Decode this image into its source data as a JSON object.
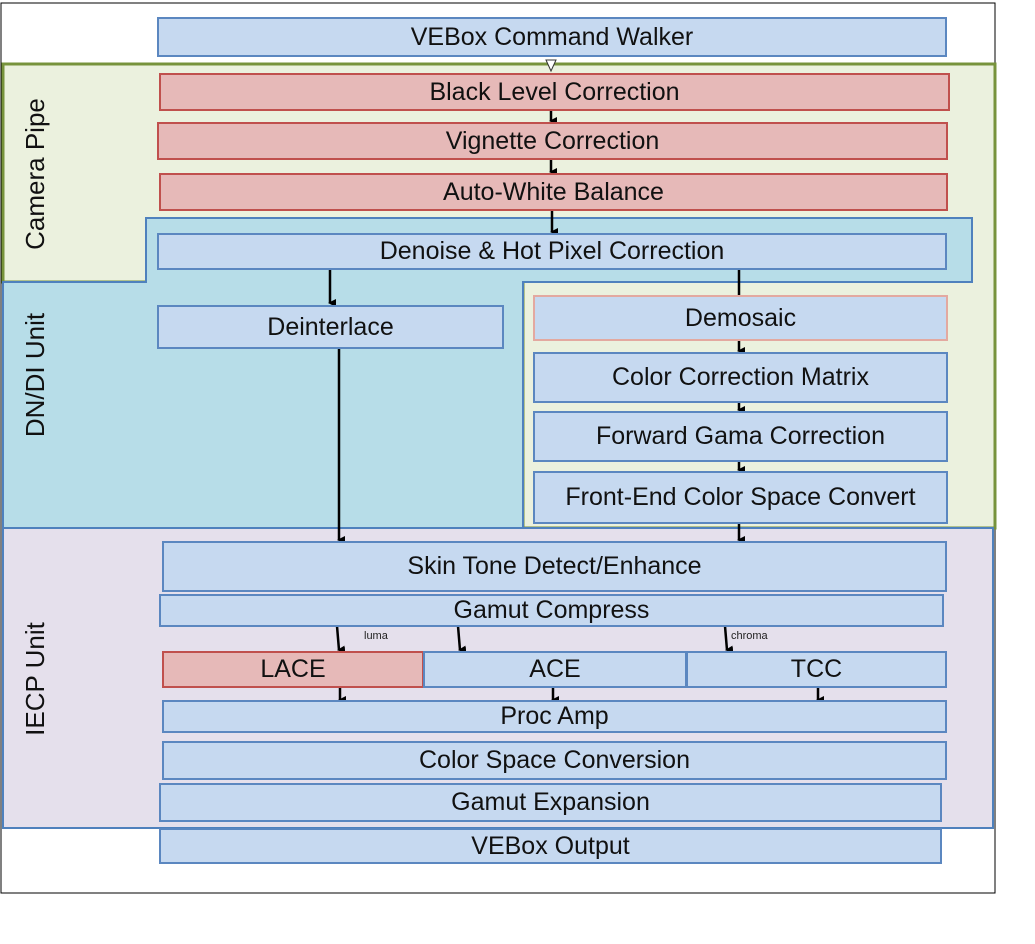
{
  "colors": {
    "blue_box": "#c6d9f0",
    "blue_border": "#4f81bd",
    "red_box": "#e6b9b8",
    "red_border": "#c0504d",
    "camera_pipe_bg": "#ebf1de",
    "camera_pipe_border": "#77933c",
    "dndi_bg": "#b7dde8",
    "iecp_bg": "#e5e0ec"
  },
  "regions": {
    "camera_pipe": "Camera Pipe",
    "dndi": "DN/DI Unit",
    "iecp": "IECP Unit"
  },
  "boxes": {
    "command_walker": "VEBox Command Walker",
    "black_level": "Black Level Correction",
    "vignette": "Vignette Correction",
    "awb": "Auto-White Balance",
    "denoise": "Denoise & Hot Pixel Correction",
    "deinterlace": "Deinterlace",
    "demosaic": "Demosaic",
    "ccm": "Color Correction Matrix",
    "forward_gamma": "Forward Gama Correction",
    "fecsc": "Front-End Color Space Convert",
    "skin_tone": "Skin Tone Detect/Enhance",
    "gamut_compress": "Gamut Compress",
    "lace": "LACE",
    "ace": "ACE",
    "tcc": "TCC",
    "proc_amp": "Proc Amp",
    "csc": "Color Space Conversion",
    "gamut_expansion": "Gamut Expansion",
    "output": "VEBox Output"
  },
  "labels": {
    "luma": "luma",
    "chroma": "chroma"
  }
}
